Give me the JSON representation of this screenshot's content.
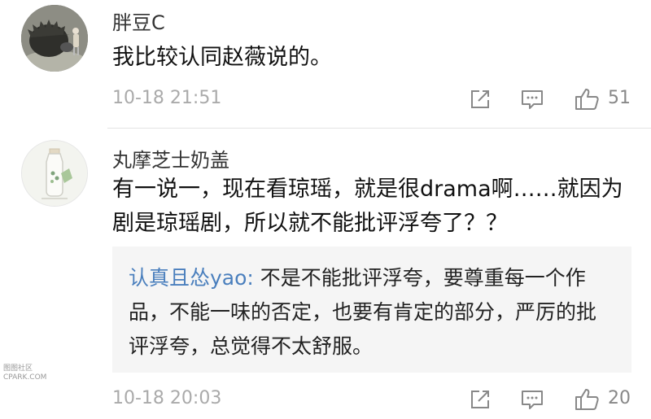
{
  "comments": [
    {
      "username": "胖豆C",
      "text": "我比较认同赵薇说的。",
      "time": "10-18 21:51",
      "likes": "51",
      "avatar_icon": "hedgehog-girl-avatar"
    },
    {
      "username": "丸摩芝士奶盖",
      "text": "有一说一，现在看琼瑶，就是很drama啊……就因为剧是琼瑶剧，所以就不能批评浮夸了？？",
      "quoted_reply": {
        "author": "认真且怂yao",
        "separator": ": ",
        "text": "不是不能批评浮夸，要尊重每一个作品，不能一味的否定，也要有肯定的部分，严厉的批评浮夸，总觉得不太舒服。"
      },
      "time": "10-18 20:03",
      "likes": "20",
      "avatar_icon": "milk-bottle-avatar"
    }
  ],
  "watermark": {
    "line1": "图图社区",
    "line2": "CPARK.COM"
  },
  "colors": {
    "link_blue": "#4a7fbd",
    "quote_bg": "#f5f5f5",
    "meta_gray": "#aaaaaa"
  }
}
